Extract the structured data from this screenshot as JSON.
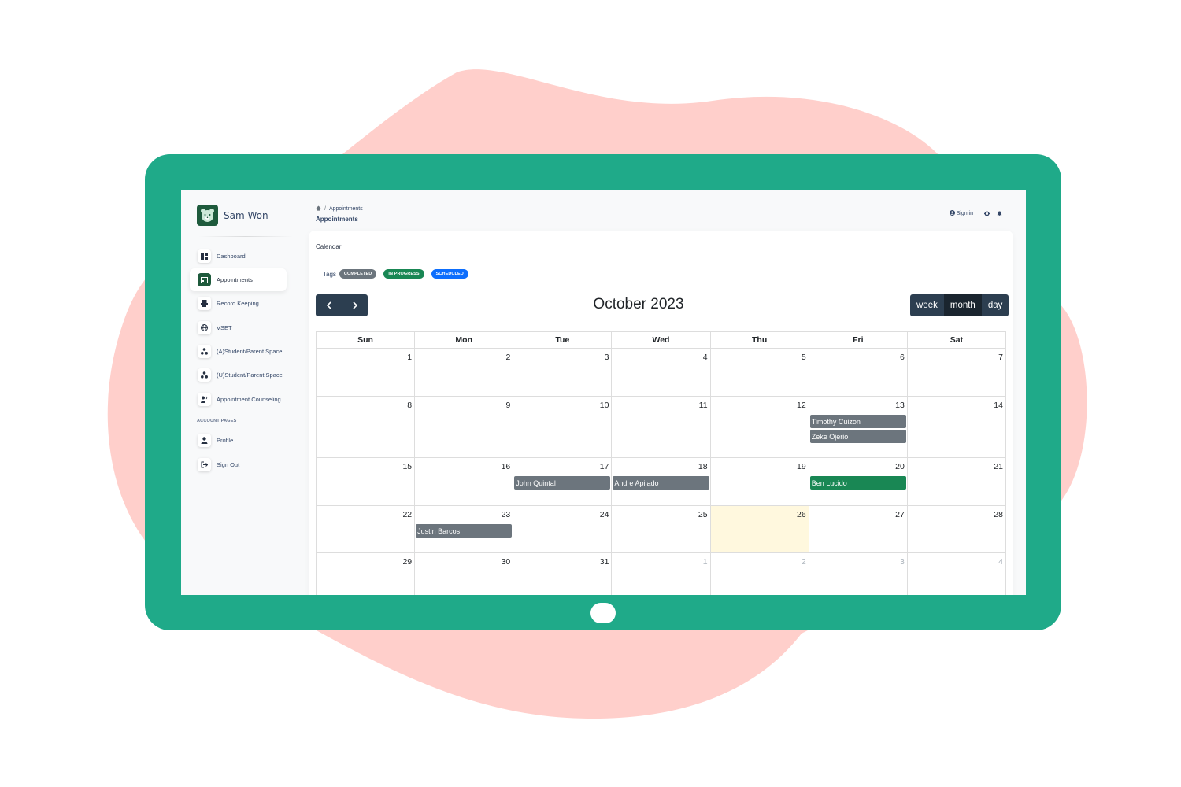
{
  "colors": {
    "backdrop_blob": "#ffcfcb",
    "tablet": "#1faa89",
    "accent": "#1e5a3c",
    "completed": "#6c757d",
    "in_progress": "#198754",
    "scheduled": "#0d6efd",
    "today": "#fff8de"
  },
  "user": {
    "name": "Sam Won",
    "logo_icon": "bear-icon"
  },
  "sidebar": {
    "items": [
      {
        "label": "Dashboard",
        "icon": "dashboard-icon",
        "active": false
      },
      {
        "label": "Appointments",
        "icon": "calendar-icon",
        "active": true
      },
      {
        "label": "Record Keeping",
        "icon": "printer-icon",
        "active": false
      },
      {
        "label": "VSET",
        "icon": "globe-icon",
        "active": false
      },
      {
        "label": "(A)Student/Parent Space",
        "icon": "group-icon",
        "active": false
      },
      {
        "label": "(U)Student/Parent Space",
        "icon": "group-icon",
        "active": false
      },
      {
        "label": "Appointment Counseling",
        "icon": "counseling-icon",
        "active": false
      }
    ],
    "account_title": "ACCOUNT PAGES",
    "account_items": [
      {
        "label": "Profile",
        "icon": "user-icon"
      },
      {
        "label": "Sign Out",
        "icon": "sign-out-icon"
      }
    ]
  },
  "header": {
    "breadcrumb": {
      "home_icon": "home-icon",
      "separator": "/",
      "current": "Appointments"
    },
    "title": "Appointments",
    "sign_in_label": "Sign in"
  },
  "calendar": {
    "card_title": "Calendar",
    "tags_label": "Tags",
    "tags": [
      {
        "label": "COMPLETED",
        "color": "#6c757d"
      },
      {
        "label": "IN PROGRESS",
        "color": "#198754"
      },
      {
        "label": "SCHEDULED",
        "color": "#0d6efd"
      }
    ],
    "title": "October 2023",
    "views": [
      "week",
      "month",
      "day"
    ],
    "active_view": "month",
    "days_of_week": [
      "Sun",
      "Mon",
      "Tue",
      "Wed",
      "Thu",
      "Fri",
      "Sat"
    ],
    "weeks": [
      [
        {
          "num": "1"
        },
        {
          "num": "2"
        },
        {
          "num": "3"
        },
        {
          "num": "4"
        },
        {
          "num": "5"
        },
        {
          "num": "6"
        },
        {
          "num": "7"
        }
      ],
      [
        {
          "num": "8"
        },
        {
          "num": "9"
        },
        {
          "num": "10"
        },
        {
          "num": "11"
        },
        {
          "num": "12"
        },
        {
          "num": "13",
          "events": [
            {
              "title": "Timothy Cuizon",
              "status": "completed"
            },
            {
              "title": "Zeke Ojerio",
              "status": "completed"
            }
          ]
        },
        {
          "num": "14"
        }
      ],
      [
        {
          "num": "15"
        },
        {
          "num": "16"
        },
        {
          "num": "17",
          "events": [
            {
              "title": "John Quintal",
              "status": "completed"
            }
          ]
        },
        {
          "num": "18",
          "events": [
            {
              "title": "Andre Apilado",
              "status": "completed"
            }
          ]
        },
        {
          "num": "19"
        },
        {
          "num": "20",
          "events": [
            {
              "title": "Ben Lucido",
              "status": "in_progress"
            }
          ]
        },
        {
          "num": "21"
        }
      ],
      [
        {
          "num": "22"
        },
        {
          "num": "23",
          "events": [
            {
              "title": "Justin Barcos",
              "status": "completed"
            }
          ]
        },
        {
          "num": "24"
        },
        {
          "num": "25"
        },
        {
          "num": "26",
          "today": true
        },
        {
          "num": "27"
        },
        {
          "num": "28"
        }
      ],
      [
        {
          "num": "29"
        },
        {
          "num": "30"
        },
        {
          "num": "31"
        },
        {
          "num": "1",
          "other_month": true
        },
        {
          "num": "2",
          "other_month": true
        },
        {
          "num": "3",
          "other_month": true
        },
        {
          "num": "4",
          "other_month": true
        }
      ]
    ]
  }
}
